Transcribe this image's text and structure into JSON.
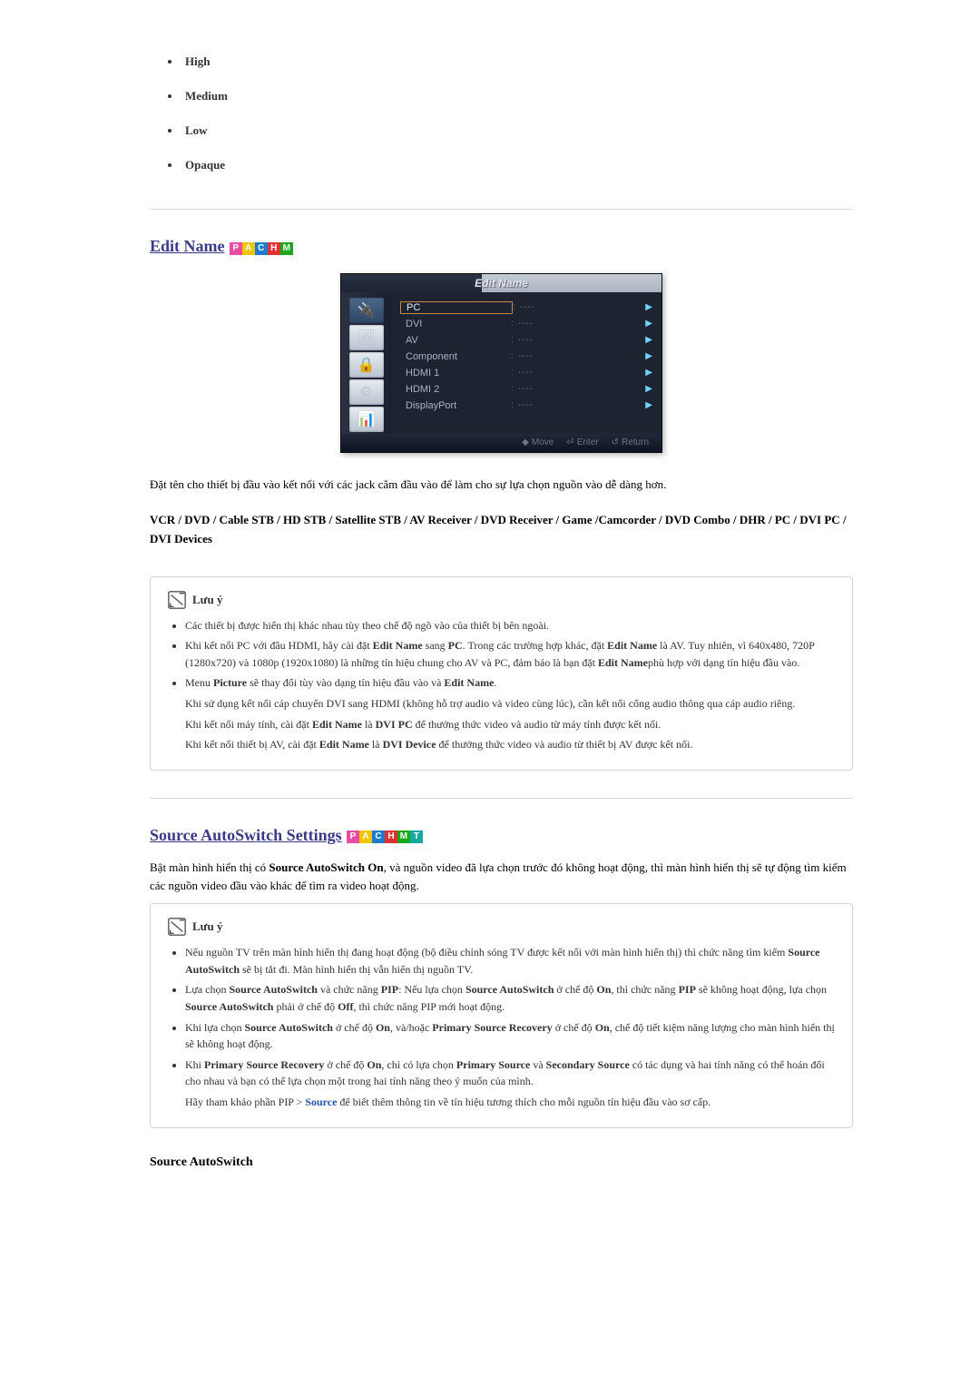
{
  "top_options": [
    "High",
    "Medium",
    "Low",
    "Opaque"
  ],
  "section1": {
    "title": "Edit Name",
    "badges": [
      "P",
      "A",
      "C",
      "H",
      "M"
    ],
    "osd": {
      "title": "Edit Name",
      "rows": [
        {
          "label": "PC",
          "selected": true
        },
        {
          "label": "DVI"
        },
        {
          "label": "AV"
        },
        {
          "label": "Component"
        },
        {
          "label": "HDMI 1"
        },
        {
          "label": "HDMI 2"
        },
        {
          "label": "DisplayPort"
        }
      ],
      "footer": {
        "move": "Move",
        "enter": "Enter",
        "ret": "Return"
      }
    },
    "intro": "Đặt tên cho thiết bị đầu vào kết nối với các jack cắm đầu vào để làm cho sự lựa chọn nguồn vào dễ dàng hơn.",
    "device_list": "VCR / DVD / Cable STB / HD STB / Satellite STB / AV Receiver / DVD Receiver / Game /Camcorder / DVD Combo / DHR / PC / DVI PC / DVI Devices",
    "note_title": "Lưu ý",
    "note_items": {
      "n1": "Các thiết bị được hiển thị khác nhau tùy theo chế độ ngõ vào của thiết bị bên ngoài.",
      "n2_a": "Khi kết nối PC với đầu HDMI, hãy cài đặt ",
      "n2_b": " sang ",
      "n2_c": ". Trong các trường hợp khác, đặt ",
      "n2_d": " là AV. Tuy nhiên, vì 640x480, 720P (1280x720) và 1080p (1920x1080) là những tín hiệu chung cho AV và PC, đảm bảo là bạn đặt ",
      "n2_e": "phù hợp với dạng tín hiệu đầu vào.",
      "n3_a": "Menu ",
      "n3_b": " sẽ thay đổi tùy vào dạng tín hiệu đầu vào và ",
      "n3_c": ".",
      "n3_sub1": "Khi sử dụng kết nối cáp chuyển DVI sang HDMI (không hỗ trợ audio và video cùng lúc), cần kết nối cổng audio thông qua cáp audio riêng.",
      "n3_sub2_a": "Khi kết nối máy tính, cài đặt ",
      "n3_sub2_b": " là ",
      "n3_sub2_c": " để thưởng thức video và audio từ máy tính được kết nối.",
      "n3_sub3_a": "Khi kết nối thiết bị AV, cài đặt ",
      "n3_sub3_b": " là ",
      "n3_sub3_c": " để thưởng thức video và audio từ thiết bị AV được kết nối.",
      "bold": {
        "edit_name": "Edit Name",
        "pc": "PC",
        "picture": "Picture",
        "dvi_pc": "DVI PC",
        "dvi_device": "DVI Device"
      }
    }
  },
  "section2": {
    "title": "Source AutoSwitch Settings",
    "badges": [
      "P",
      "A",
      "C",
      "H",
      "M",
      "T"
    ],
    "intro_a": "Bật màn hình hiển thị có ",
    "intro_b": ", và nguồn video đã lựa chọn trước đó không hoạt động, thì màn hình hiển thị sẽ tự động tìm kiếm các nguồn video đầu vào khác để tìm ra video hoạt động.",
    "intro_bold": "Source AutoSwitch On",
    "note_title": "Lưu ý",
    "notes": {
      "n1_a": "Nếu nguồn TV trên màn hình hiển thị đang hoạt động (bộ điều chỉnh sóng TV được kết nối với màn hình hiển thị) thì chức năng tìm kiếm ",
      "n1_b": " sẽ bị tắt đi. Màn hình hiển thị vẫn hiển thị nguồn TV.",
      "n2_a": "Lựa chọn ",
      "n2_b": " và chức năng ",
      "n2_c": ": Nếu lựa chọn ",
      "n2_d": " ở chế độ ",
      "n2_e": ", thì chức năng ",
      "n2_f": " sẽ không hoạt động, lựa chọn ",
      "n2_g": " phải ở chế độ ",
      "n2_h": ", thì chức năng PIP mới hoạt động.",
      "n3_a": "Khi lựa chọn ",
      "n3_b": " ở chế độ ",
      "n3_c": ", và/hoặc ",
      "n3_d": " ở chế độ ",
      "n3_e": ", chế độ tiết kiệm năng lượng cho màn hình hiển thị sẽ không hoạt động.",
      "n4_a": "Khi ",
      "n4_b": " ở chế độ ",
      "n4_c": ", chỉ có lựa chọn ",
      "n4_d": " và ",
      "n4_e": " có tác dụng và hai tính năng có thể hoán đổi cho nhau và bạn có thể lựa chọn một trong hai tính năng theo ý muốn của mình.",
      "n4_sub_a": "Hãy tham khảo phần PIP > ",
      "n4_sub_link": "Source",
      "n4_sub_b": " để biết thêm thông tin về tín hiệu tương thích cho mỗi nguồn tín hiệu đầu vào sơ cấp.",
      "bold": {
        "sas": "Source AutoSwitch",
        "pip": "PIP",
        "on": "On",
        "off": "Off",
        "psr": "Primary Source Recovery",
        "ps": "Primary Source",
        "ss": "Secondary Source"
      }
    },
    "subhead": "Source AutoSwitch"
  }
}
